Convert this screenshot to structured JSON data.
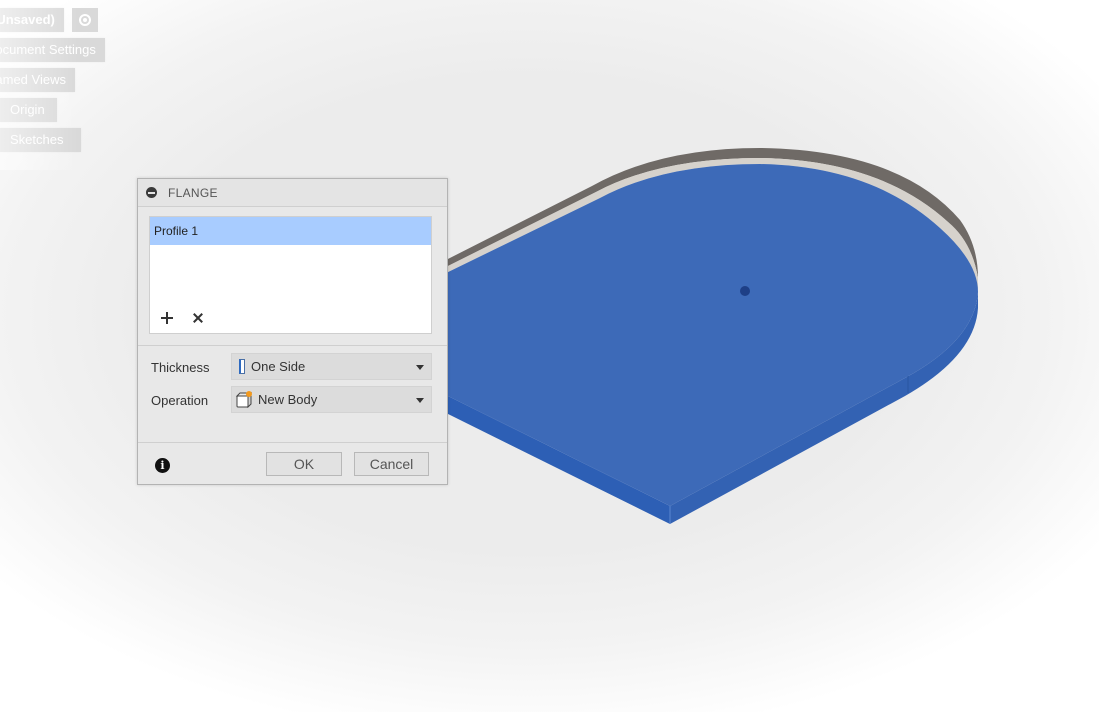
{
  "browser": {
    "document_tab": "(Unsaved)",
    "settings_icon": "target-icon",
    "items": [
      {
        "label": "Document Settings"
      },
      {
        "label": "Named Views"
      },
      {
        "label": "Origin"
      },
      {
        "label": "Sketches"
      }
    ]
  },
  "dialog": {
    "title": "FLANGE",
    "collapse_icon": "minus-circle-icon",
    "profiles": [
      "Profile 1"
    ],
    "add_icon": "plus-icon",
    "remove_icon": "x-icon",
    "thickness": {
      "label": "Thickness",
      "value": "One Side",
      "icon": "one-side-icon"
    },
    "operation": {
      "label": "Operation",
      "value": "New Body",
      "icon": "new-body-icon"
    },
    "info_icon": "info-icon",
    "ok_label": "OK",
    "cancel_label": "Cancel"
  },
  "model": {
    "face_color": "#3d6ab8",
    "edge_color": "#2d56a8",
    "rim_color": "#7a7570"
  }
}
